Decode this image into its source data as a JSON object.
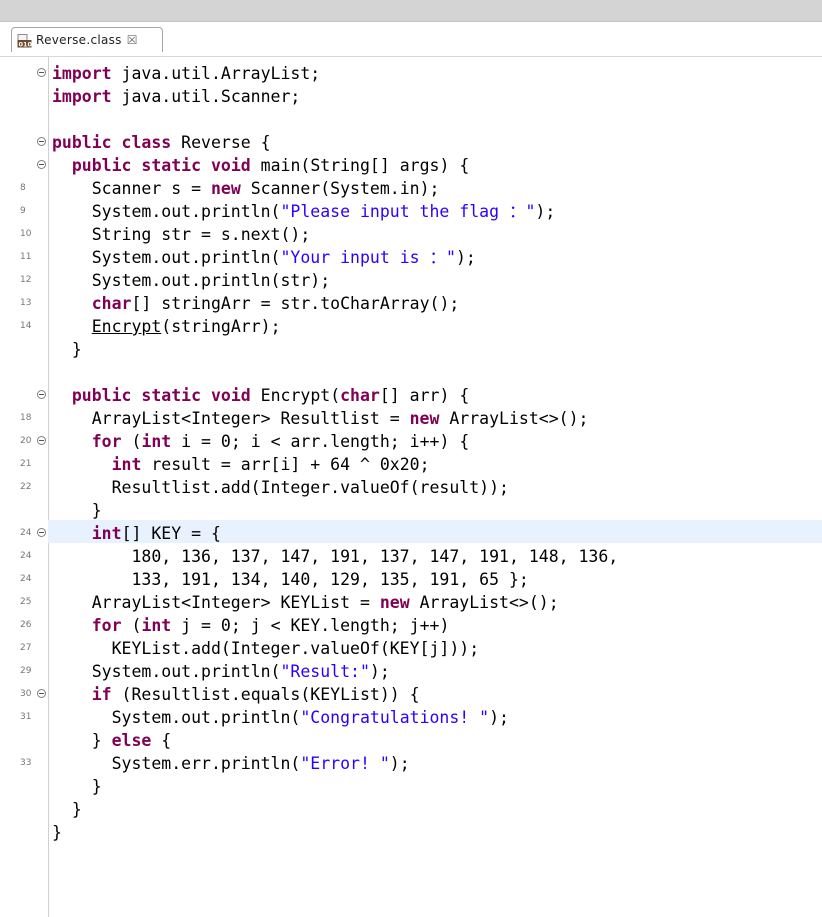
{
  "tab": {
    "label": "Reverse.class",
    "close_glyph": "☒",
    "icon": "class-file-icon"
  },
  "lines": [
    {
      "num": "",
      "fold": true,
      "tokens": [
        {
          "t": "import",
          "c": "kw"
        },
        {
          "t": " java.util.ArrayList;"
        }
      ]
    },
    {
      "num": "",
      "fold": false,
      "tokens": [
        {
          "t": "import",
          "c": "kw"
        },
        {
          "t": " java.util.Scanner;"
        }
      ]
    },
    {
      "num": "",
      "fold": false,
      "tokens": []
    },
    {
      "num": "",
      "fold": true,
      "tokens": [
        {
          "t": "public",
          "c": "kw"
        },
        {
          "t": " "
        },
        {
          "t": "class",
          "c": "kw"
        },
        {
          "t": " Reverse {"
        }
      ]
    },
    {
      "num": "",
      "fold": true,
      "tokens": [
        {
          "t": "  "
        },
        {
          "t": "public",
          "c": "kw"
        },
        {
          "t": " "
        },
        {
          "t": "static",
          "c": "kw"
        },
        {
          "t": " "
        },
        {
          "t": "void",
          "c": "kw"
        },
        {
          "t": " main(String[] args) {"
        }
      ]
    },
    {
      "num": "8",
      "fold": false,
      "tokens": [
        {
          "t": "    Scanner s = "
        },
        {
          "t": "new",
          "c": "kw"
        },
        {
          "t": " Scanner(System.in);"
        }
      ]
    },
    {
      "num": "9",
      "fold": false,
      "tokens": [
        {
          "t": "    System.out.println("
        },
        {
          "t": "\"Please input the flag ：\"",
          "c": "str"
        },
        {
          "t": ");"
        }
      ]
    },
    {
      "num": "10",
      "fold": false,
      "tokens": [
        {
          "t": "    String str = s.next();"
        }
      ]
    },
    {
      "num": "11",
      "fold": false,
      "tokens": [
        {
          "t": "    System.out.println("
        },
        {
          "t": "\"Your input is ：\"",
          "c": "str"
        },
        {
          "t": ");"
        }
      ]
    },
    {
      "num": "12",
      "fold": false,
      "tokens": [
        {
          "t": "    System.out.println(str);"
        }
      ]
    },
    {
      "num": "13",
      "fold": false,
      "tokens": [
        {
          "t": "    "
        },
        {
          "t": "char",
          "c": "kw"
        },
        {
          "t": "[] stringArr = str.toCharArray();"
        }
      ]
    },
    {
      "num": "14",
      "fold": false,
      "tokens": [
        {
          "t": "    "
        },
        {
          "t": "Encrypt",
          "c": "ul"
        },
        {
          "t": "(stringArr);"
        }
      ]
    },
    {
      "num": "",
      "fold": false,
      "tokens": [
        {
          "t": "  }"
        }
      ]
    },
    {
      "num": "",
      "fold": false,
      "tokens": []
    },
    {
      "num": "",
      "fold": true,
      "tokens": [
        {
          "t": "  "
        },
        {
          "t": "public",
          "c": "kw"
        },
        {
          "t": " "
        },
        {
          "t": "static",
          "c": "kw"
        },
        {
          "t": " "
        },
        {
          "t": "void",
          "c": "kw"
        },
        {
          "t": " Encrypt("
        },
        {
          "t": "char",
          "c": "kw"
        },
        {
          "t": "[] arr) {"
        }
      ]
    },
    {
      "num": "18",
      "fold": false,
      "tokens": [
        {
          "t": "    ArrayList<Integer> Resultlist = "
        },
        {
          "t": "new",
          "c": "kw"
        },
        {
          "t": " ArrayList<>();"
        }
      ]
    },
    {
      "num": "20",
      "fold": true,
      "tokens": [
        {
          "t": "    "
        },
        {
          "t": "for",
          "c": "kw"
        },
        {
          "t": " ("
        },
        {
          "t": "int",
          "c": "kw"
        },
        {
          "t": " i = 0; i < arr.length; i++) {"
        }
      ]
    },
    {
      "num": "21",
      "fold": false,
      "tokens": [
        {
          "t": "      "
        },
        {
          "t": "int",
          "c": "kw"
        },
        {
          "t": " result = arr[i] + 64 ^ 0x20;"
        }
      ]
    },
    {
      "num": "22",
      "fold": false,
      "tokens": [
        {
          "t": "      Resultlist.add(Integer.valueOf(result));"
        }
      ]
    },
    {
      "num": "",
      "fold": false,
      "tokens": [
        {
          "t": "    }"
        }
      ]
    },
    {
      "num": "24",
      "fold": true,
      "tokens": [
        {
          "t": "    "
        },
        {
          "t": "int",
          "c": "kw"
        },
        {
          "t": "[] KEY = {"
        }
      ]
    },
    {
      "num": "24",
      "fold": false,
      "tokens": [
        {
          "t": "        180, 136, 137, 147, 191, 137, 147, 191, 148, 136,"
        }
      ]
    },
    {
      "num": "24",
      "fold": false,
      "tokens": [
        {
          "t": "        133, 191, 134, 140, 129, 135, 191, 65 };"
        }
      ]
    },
    {
      "num": "25",
      "fold": false,
      "tokens": [
        {
          "t": "    ArrayList<Integer> KEYList = "
        },
        {
          "t": "new",
          "c": "kw"
        },
        {
          "t": " ArrayList<>();"
        }
      ]
    },
    {
      "num": "26",
      "fold": false,
      "tokens": [
        {
          "t": "    "
        },
        {
          "t": "for",
          "c": "kw"
        },
        {
          "t": " ("
        },
        {
          "t": "int",
          "c": "kw"
        },
        {
          "t": " j = 0; j < KEY.length; j++)"
        }
      ]
    },
    {
      "num": "27",
      "fold": false,
      "tokens": [
        {
          "t": "      KEYList.add(Integer.valueOf(KEY[j]));"
        }
      ]
    },
    {
      "num": "29",
      "fold": false,
      "tokens": [
        {
          "t": "    System.out.println("
        },
        {
          "t": "\"Result:\"",
          "c": "str"
        },
        {
          "t": ");"
        }
      ]
    },
    {
      "num": "30",
      "fold": true,
      "tokens": [
        {
          "t": "    "
        },
        {
          "t": "if",
          "c": "kw"
        },
        {
          "t": " (Resultlist.equals(KEYList)) {"
        }
      ]
    },
    {
      "num": "31",
      "fold": false,
      "tokens": [
        {
          "t": "      System.out.println("
        },
        {
          "t": "\"Congratulations! \"",
          "c": "str"
        },
        {
          "t": ");"
        }
      ]
    },
    {
      "num": "",
      "fold": false,
      "tokens": [
        {
          "t": "    } "
        },
        {
          "t": "else",
          "c": "kw"
        },
        {
          "t": " {"
        }
      ]
    },
    {
      "num": "33",
      "fold": false,
      "tokens": [
        {
          "t": "      System.err.println("
        },
        {
          "t": "\"Error! \"",
          "c": "str"
        },
        {
          "t": ");"
        }
      ]
    },
    {
      "num": "",
      "fold": false,
      "tokens": [
        {
          "t": "    }"
        }
      ]
    },
    {
      "num": "",
      "fold": false,
      "tokens": [
        {
          "t": "  }"
        }
      ]
    },
    {
      "num": "",
      "fold": false,
      "tokens": [
        {
          "t": "}"
        }
      ]
    }
  ],
  "colors": {
    "keyword": "#7f0055",
    "string": "#2a00ff",
    "text": "#000000",
    "current_line": "#e8f2fe"
  }
}
